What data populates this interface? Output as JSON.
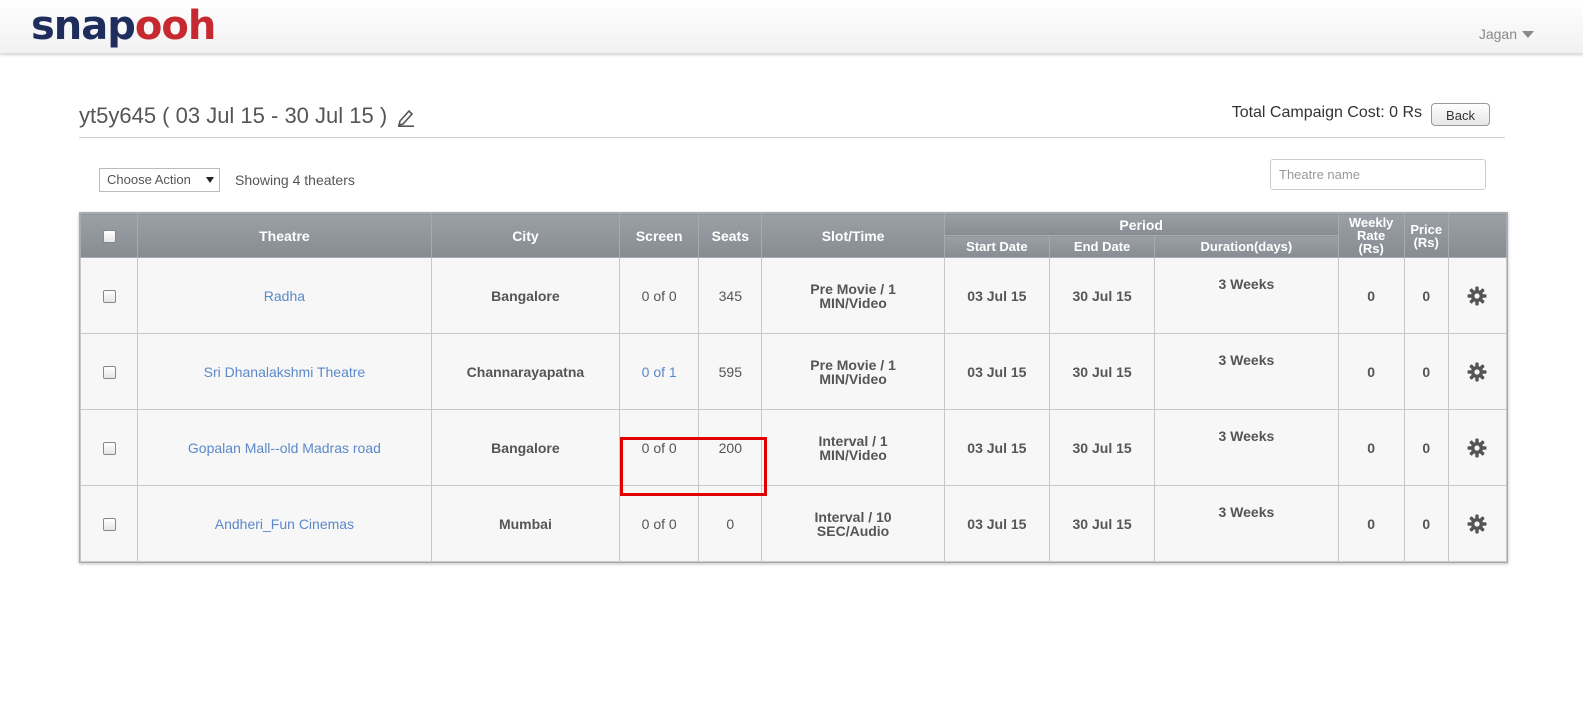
{
  "header": {
    "logo_part1": "snap",
    "logo_part2": "ooh",
    "user_name": "Jagan"
  },
  "campaign": {
    "title": "yt5y645 ( 03 Jul 15 - 30 Jul 15 )",
    "total_cost": "Total Campaign Cost: 0 Rs",
    "back_label": "Back"
  },
  "toolbar": {
    "choose_action": "Choose Action",
    "showing": "Showing 4 theaters",
    "search_placeholder": "Theatre name"
  },
  "table": {
    "headers": {
      "theatre": "Theatre",
      "city": "City",
      "screen": "Screen",
      "seats": "Seats",
      "slot": "Slot/Time",
      "period": "Period",
      "start": "Start Date",
      "end": "End Date",
      "duration": "Duration(days)",
      "weekly_rate_1": "Weekly",
      "weekly_rate_2": "Rate",
      "weekly_rate_3": "(Rs)",
      "price_1": "Price",
      "price_2": "(Rs)"
    },
    "rows": [
      {
        "theatre": "Radha",
        "city": "Bangalore",
        "screen": "0 of 0",
        "seats": "345",
        "slot1": "Pre Movie / 1",
        "slot2": "MIN/Video",
        "start": "03 Jul 15",
        "end": "30 Jul 15",
        "duration": "3 Weeks",
        "rate": "0",
        "price": "0"
      },
      {
        "theatre": "Sri Dhanalakshmi Theatre",
        "city": "Channarayapatna",
        "screen": "0 of 1",
        "seats": "595",
        "slot1": "Pre Movie / 1",
        "slot2": "MIN/Video",
        "start": "03 Jul 15",
        "end": "30 Jul 15",
        "duration": "3 Weeks",
        "rate": "0",
        "price": "0"
      },
      {
        "theatre": "Gopalan Mall--old Madras road",
        "city": "Bangalore",
        "screen": "0 of 0",
        "seats": "200",
        "slot1": "Interval / 1",
        "slot2": "MIN/Video",
        "start": "03 Jul 15",
        "end": "30 Jul 15",
        "duration": "3 Weeks",
        "rate": "0",
        "price": "0"
      },
      {
        "theatre": "Andheri_Fun Cinemas",
        "city": "Mumbai",
        "screen": "0 of 0",
        "seats": "0",
        "slot1": "Interval / 10",
        "slot2": "SEC/Audio",
        "start": "03 Jul 15",
        "end": "30 Jul 15",
        "duration": "3 Weeks",
        "rate": "0",
        "price": "0"
      }
    ]
  },
  "colors": {
    "link": "#5b89c9",
    "header_bg": "#8f959b",
    "highlight": "#e00000",
    "logo_dark": "#1f2d5c",
    "logo_red": "#c62a30"
  }
}
